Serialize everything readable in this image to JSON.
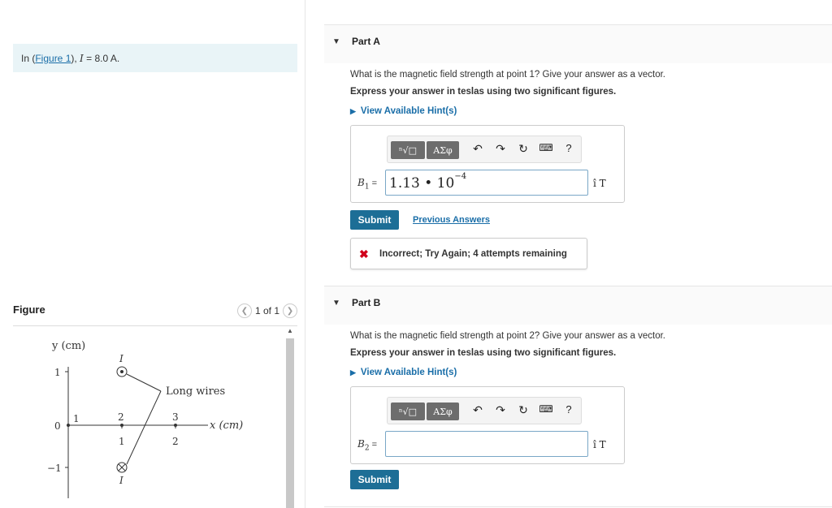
{
  "intro": {
    "prefix": "In (",
    "figure_link": "Figure 1",
    "suffix": "), ",
    "current_var": "I",
    "current_eq": " = 8.0 A."
  },
  "figure_panel": {
    "title": "Figure",
    "pager_text": "1 of 1",
    "prev_icon": "chevron-left-icon",
    "next_icon": "chevron-right-icon"
  },
  "diagram": {
    "y_axis_label": "y (cm)",
    "x_axis_label": "x (cm)",
    "y_tick_1": "1",
    "y_tick_0": "0",
    "y_tick_m1": "−1",
    "wire_top_label": "I",
    "wire_bottom_label": "I",
    "callout": "Long wires",
    "point_1": "1",
    "point_2": "2",
    "point_3": "3",
    "x_tick_1": "1",
    "x_tick_2": "2"
  },
  "toolbar": {
    "templates_label": "ⁿ√□",
    "greek_label": "ΑΣφ",
    "undo_icon": "undo-icon",
    "redo_icon": "redo-icon",
    "reset_icon": "reset-icon",
    "keyboard_icon": "keyboard-icon",
    "help_label": "?"
  },
  "part_a": {
    "title": "Part A",
    "question": "What is the magnetic field strength at point 1? Give your answer as a vector.",
    "instruction": "Express your answer in teslas using two significant figures.",
    "hint_label": "View Available Hint(s)",
    "var_letter": "B",
    "var_sub": "1",
    "var_eq": "=",
    "answer_mantissa": "1.13 • 10",
    "answer_exp": "−4",
    "unit": "î T",
    "submit_label": "Submit",
    "previous_answers": "Previous Answers",
    "feedback": "Incorrect; Try Again; 4 attempts remaining"
  },
  "part_b": {
    "title": "Part B",
    "question": "What is the magnetic field strength at point 2? Give your answer as a vector.",
    "instruction": "Express your answer in teslas using two significant figures.",
    "hint_label": "View Available Hint(s)",
    "var_letter": "B",
    "var_sub": "2",
    "var_eq": "=",
    "answer_value": "",
    "unit": "î T",
    "submit_label": "Submit"
  }
}
